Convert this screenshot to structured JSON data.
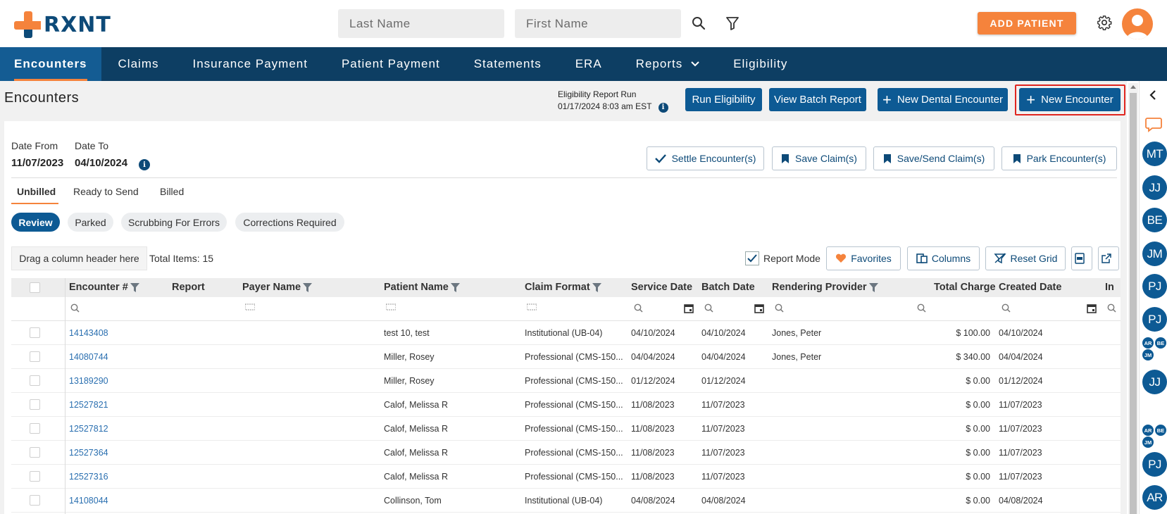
{
  "header": {
    "logo_text": "RXNT",
    "last_name_placeholder": "Last Name",
    "first_name_placeholder": "First Name",
    "add_patient_label": "ADD PATIENT"
  },
  "nav": {
    "items": [
      "Encounters",
      "Claims",
      "Insurance Payment",
      "Patient Payment",
      "Statements",
      "ERA",
      "Reports",
      "Eligibility"
    ],
    "active": "Encounters"
  },
  "page": {
    "title": "Encounters",
    "eligibility_label": "Eligibility Report Run",
    "eligibility_time": "01/17/2024 8:03 am EST",
    "run_eligibility": "Run Eligibility",
    "view_batch_report": "View Batch Report",
    "new_dental_encounter": "New Dental Encounter",
    "new_encounter": "New Encounter"
  },
  "filters": {
    "date_from_label": "Date From",
    "date_from_value": "11/07/2023",
    "date_to_label": "Date To",
    "date_to_value": "04/10/2024",
    "settle": "Settle Encounter(s)",
    "save_claims": "Save Claim(s)",
    "save_send_claims": "Save/Send Claim(s)",
    "park": "Park Encounter(s)"
  },
  "tabs": [
    "Unbilled",
    "Ready to Send",
    "Billed"
  ],
  "pills": [
    "Review",
    "Parked",
    "Scrubbing For Errors",
    "Corrections Required"
  ],
  "toolbar": {
    "drag_hint": "Drag a column header here",
    "total_items": "Total Items: 15",
    "report_mode": "Report Mode",
    "favorites": "Favorites",
    "columns": "Columns",
    "reset_grid": "Reset Grid"
  },
  "grid": {
    "columns": [
      "Encounter #",
      "Report",
      "Payer Name",
      "Patient Name",
      "Claim Format",
      "Service Date",
      "Batch Date",
      "Rendering Provider",
      "Total Charge",
      "Created Date",
      "In"
    ],
    "rows": [
      {
        "encounter": "14143408",
        "payer": "",
        "patient": "test 10, test",
        "format": "Institutional (UB-04)",
        "service": "04/10/2024",
        "batch": "04/10/2024",
        "provider": "Jones, Peter",
        "charge": "$ 100.00",
        "created": "04/10/2024"
      },
      {
        "encounter": "14080744",
        "payer": "",
        "patient": "Miller, Rosey",
        "format": "Professional (CMS-150...",
        "service": "04/04/2024",
        "batch": "04/04/2024",
        "provider": "Jones, Peter",
        "charge": "$ 340.00",
        "created": "04/04/2024"
      },
      {
        "encounter": "13189290",
        "payer": "",
        "patient": "Miller, Rosey",
        "format": "Professional (CMS-150...",
        "service": "01/12/2024",
        "batch": "01/12/2024",
        "provider": "",
        "charge": "$ 0.00",
        "created": "01/12/2024"
      },
      {
        "encounter": "12527821",
        "payer": "",
        "patient": "Calof, Melissa R",
        "format": "Professional (CMS-150...",
        "service": "11/08/2023",
        "batch": "11/07/2023",
        "provider": "",
        "charge": "$ 0.00",
        "created": "11/07/2023"
      },
      {
        "encounter": "12527812",
        "payer": "",
        "patient": "Calof, Melissa R",
        "format": "Professional (CMS-150...",
        "service": "11/08/2023",
        "batch": "11/07/2023",
        "provider": "",
        "charge": "$ 0.00",
        "created": "11/07/2023"
      },
      {
        "encounter": "12527364",
        "payer": "",
        "patient": "Calof, Melissa R",
        "format": "Professional (CMS-150...",
        "service": "11/08/2023",
        "batch": "11/07/2023",
        "provider": "",
        "charge": "$ 0.00",
        "created": "11/07/2023"
      },
      {
        "encounter": "12527316",
        "payer": "",
        "patient": "Calof, Melissa R",
        "format": "Professional (CMS-150...",
        "service": "11/08/2023",
        "batch": "11/07/2023",
        "provider": "",
        "charge": "$ 0.00",
        "created": "11/07/2023"
      },
      {
        "encounter": "14108044",
        "payer": "",
        "patient": "Collinson, Tom",
        "format": "Institutional (UB-04)",
        "service": "04/08/2024",
        "batch": "04/08/2024",
        "provider": "",
        "charge": "$ 0.00",
        "created": "04/08/2024"
      }
    ]
  },
  "rail": {
    "avatars": [
      "MT",
      "JJ",
      "BE",
      "JM",
      "PJ",
      "PJ",
      "JJ",
      "PJ",
      "AR"
    ],
    "mini_group": [
      "AR",
      "BE",
      "JM"
    ]
  },
  "colors": {
    "brand_orange": "#f5833c",
    "brand_navy": "#0d3e63",
    "primary_button": "#0d5a94",
    "link": "#2a6fb0"
  }
}
